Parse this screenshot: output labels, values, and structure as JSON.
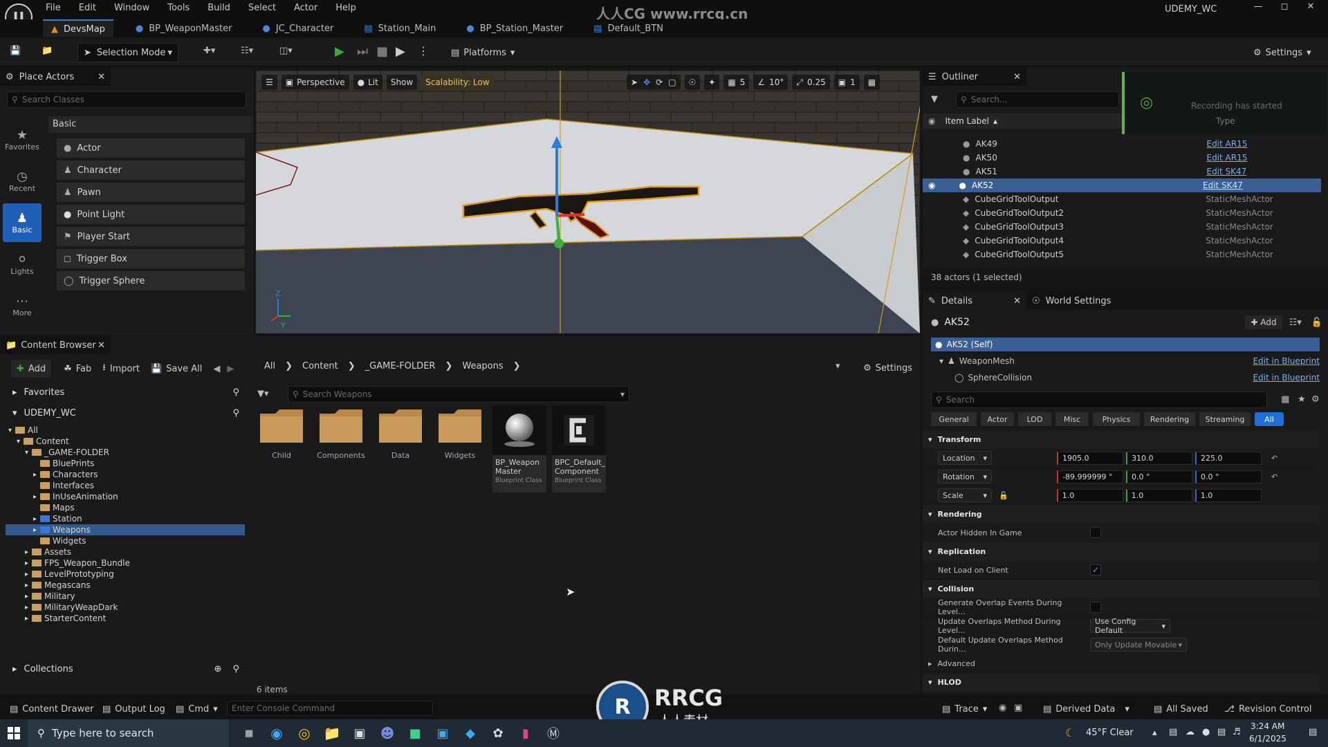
{
  "app": {
    "menu": [
      "File",
      "Edit",
      "Window",
      "Tools",
      "Build",
      "Select",
      "Actor",
      "Help"
    ],
    "project": "UDEMY_WC",
    "site_watermark": "人人CG www.rrcg.cn",
    "doc_tabs": [
      {
        "label": "DevsMap",
        "active": true
      },
      {
        "label": "BP_WeaponMaster",
        "active": false
      },
      {
        "label": "JC_Character",
        "active": false
      },
      {
        "label": "Station_Main",
        "active": false
      },
      {
        "label": "BP_Station_Master",
        "active": false
      },
      {
        "label": "Default_BTN",
        "active": false
      }
    ]
  },
  "toolbar": {
    "selection_mode": "Selection Mode",
    "platforms": "Platforms",
    "settings": "Settings"
  },
  "place_actors": {
    "tab": "Place Actors",
    "search_placeholder": "Search Classes",
    "category_header": "Basic",
    "categories": [
      "Favorites",
      "Recent",
      "Basic",
      "Lights",
      "More"
    ],
    "items": [
      "Actor",
      "Character",
      "Pawn",
      "Point Light",
      "Player Start",
      "Trigger Box",
      "Trigger Sphere"
    ]
  },
  "viewport": {
    "perspective": "Perspective",
    "lit": "Lit",
    "show": "Show",
    "scalability": "Scalability: Low",
    "grid_snap": "5",
    "rot_snap": "10°",
    "scale_snap": "0.25",
    "cam_speed": "1",
    "axis_z": "Z",
    "axis_y": "Y"
  },
  "outliner": {
    "tab": "Outliner",
    "search_placeholder": "Search...",
    "col_label": "Item Label",
    "col_type": "Type",
    "rows": [
      {
        "name": "AK49",
        "type": "Edit AR15",
        "link": true,
        "selected": false
      },
      {
        "name": "AK50",
        "type": "Edit AR15",
        "link": true,
        "selected": false
      },
      {
        "name": "AK51",
        "type": "Edit SK47",
        "link": true,
        "selected": false
      },
      {
        "name": "AK52",
        "type": "Edit SK47",
        "link": true,
        "selected": true
      },
      {
        "name": "CubeGridToolOutput",
        "type": "StaticMeshActor",
        "link": false,
        "selected": false
      },
      {
        "name": "CubeGridToolOutput2",
        "type": "StaticMeshActor",
        "link": false,
        "selected": false
      },
      {
        "name": "CubeGridToolOutput3",
        "type": "StaticMeshActor",
        "link": false,
        "selected": false
      },
      {
        "name": "CubeGridToolOutput4",
        "type": "StaticMeshActor",
        "link": false,
        "selected": false
      },
      {
        "name": "CubeGridToolOutput5",
        "type": "StaticMeshActor",
        "link": false,
        "selected": false
      }
    ],
    "footer": "38 actors (1 selected)",
    "recording": "Recording has started"
  },
  "details": {
    "tab": "Details",
    "world_tab": "World Settings",
    "actor_name": "AK52",
    "add": "Add",
    "self_row": "AK52 (Self)",
    "components": [
      {
        "name": "WeaponMesh",
        "action": "Edit in Blueprint"
      },
      {
        "name": "SphereCollision",
        "action": "Edit in Blueprint"
      }
    ],
    "search_placeholder": "Search",
    "filters": [
      "General",
      "Actor",
      "LOD",
      "Misc",
      "Physics",
      "Rendering",
      "Streaming",
      "All"
    ],
    "transform": {
      "section": "Transform",
      "location_label": "Location",
      "location": [
        "1905.0",
        "310.0",
        "225.0"
      ],
      "rotation_label": "Rotation",
      "rotation": [
        "-89.999999 °",
        "0.0 °",
        "0.0 °"
      ],
      "scale_label": "Scale",
      "scale": [
        "1.0",
        "1.0",
        "1.0"
      ]
    },
    "rendering": {
      "section": "Rendering",
      "hidden_in_game": "Actor Hidden In Game"
    },
    "replication": {
      "section": "Replication",
      "net_load": "Net Load on Client"
    },
    "collision": {
      "section": "Collision",
      "gen_overlap": "Generate Overlap Events During Level...",
      "update_method": "Update Overlaps Method During Level...",
      "update_value": "Use Config Default",
      "default_method": "Default Update Overlaps Method Durin...",
      "default_value": "Only Update Movable"
    },
    "advanced": "Advanced",
    "hlod": "HLOD"
  },
  "content_browser": {
    "tab": "Content Browser",
    "add": "Add",
    "fab": "Fab",
    "import": "Import",
    "save_all": "Save All",
    "breadcrumb": [
      "All",
      "Content",
      "_GAME-FOLDER",
      "Weapons"
    ],
    "settings": "Settings",
    "favorites": "Favorites",
    "project_root": "UDEMY_WC",
    "search_placeholder": "Search Weapons",
    "tree": [
      {
        "label": "All",
        "depth": 0,
        "selected": false
      },
      {
        "label": "Content",
        "depth": 1,
        "selected": false
      },
      {
        "label": "_GAME-FOLDER",
        "depth": 2,
        "selected": false
      },
      {
        "label": "BluePrints",
        "depth": 3,
        "selected": false
      },
      {
        "label": "Characters",
        "depth": 3,
        "selected": false
      },
      {
        "label": "Interfaces",
        "depth": 3,
        "selected": false
      },
      {
        "label": "InUseAnimation",
        "depth": 3,
        "selected": false
      },
      {
        "label": "Maps",
        "depth": 3,
        "selected": false
      },
      {
        "label": "Station",
        "depth": 3,
        "selected": false
      },
      {
        "label": "Weapons",
        "depth": 3,
        "selected": true
      },
      {
        "label": "Widgets",
        "depth": 3,
        "selected": false
      },
      {
        "label": "Assets",
        "depth": 2,
        "selected": false
      },
      {
        "label": "FPS_Weapon_Bundle",
        "depth": 2,
        "selected": false
      },
      {
        "label": "LevelPrototyping",
        "depth": 2,
        "selected": false
      },
      {
        "label": "Megascans",
        "depth": 2,
        "selected": false
      },
      {
        "label": "Military",
        "depth": 2,
        "selected": false
      },
      {
        "label": "MilitaryWeapDark",
        "depth": 2,
        "selected": false
      },
      {
        "label": "StarterContent",
        "depth": 2,
        "selected": false
      }
    ],
    "folders": [
      "Child",
      "Components",
      "Data",
      "Widgets"
    ],
    "blueprints": [
      {
        "name": "BP_Weapon Master",
        "class": "Blueprint Class"
      },
      {
        "name": "BPC_Default_ Component",
        "class": "Blueprint Class"
      }
    ],
    "item_count": "6 items",
    "collections": "Collections"
  },
  "statusbar": {
    "content_drawer": "Content Drawer",
    "output_log": "Output Log",
    "cmd": "Cmd",
    "console_placeholder": "Enter Console Command",
    "trace": "Trace",
    "derived_data": "Derived Data",
    "all_saved": "All Saved",
    "revision_control": "Revision Control"
  },
  "taskbar": {
    "search_placeholder": "Type here to search",
    "weather": "45°F  Clear",
    "time": "3:24 AM",
    "date": "6/1/2025",
    "logo_text": "RRCG",
    "logo_sub": "人人素材"
  },
  "colors": {
    "accent": "#1f6fd6",
    "selection": "#3a5f95",
    "play_green": "#43a53c",
    "folder": "#c8a060"
  }
}
